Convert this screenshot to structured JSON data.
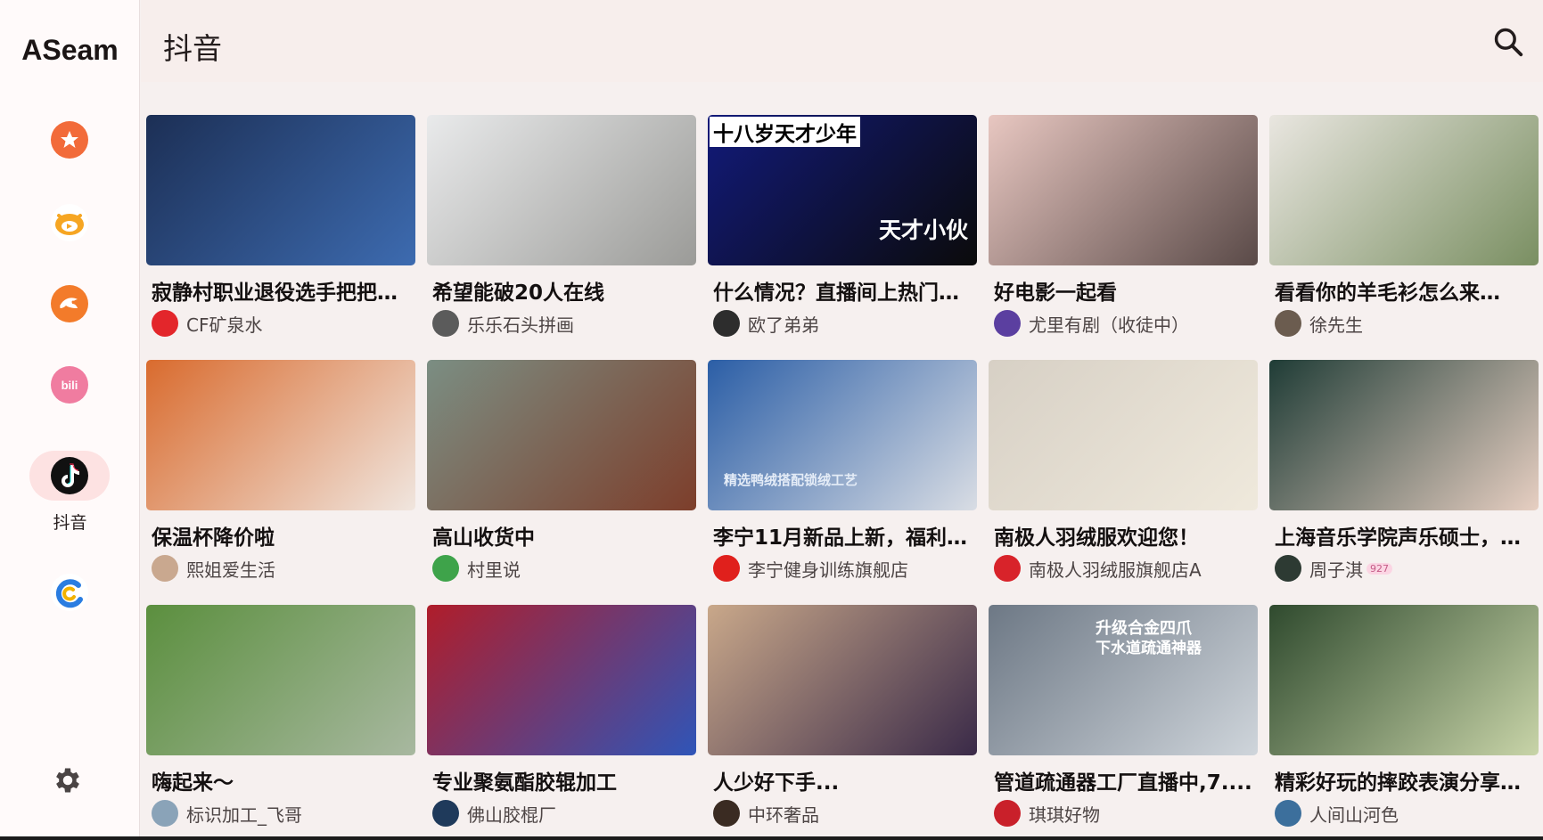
{
  "app": {
    "brand": "ASeam"
  },
  "rail": {
    "items": [
      {
        "id": "favorites",
        "icon": "star-icon",
        "color": "#f26b3a",
        "label": ""
      },
      {
        "id": "huya",
        "icon": "huya-icon",
        "color": "#f6a623",
        "label": ""
      },
      {
        "id": "douyu",
        "icon": "douyu-icon",
        "color": "#f37b2a",
        "label": ""
      },
      {
        "id": "bilibili",
        "icon": "bilibili-icon",
        "color": "#f07ca0",
        "label": ""
      },
      {
        "id": "douyin",
        "icon": "douyin-icon",
        "color": "#111111",
        "label": "抖音",
        "active": true
      },
      {
        "id": "cc",
        "icon": "cc-icon",
        "color": "#2a7de1",
        "label": ""
      }
    ],
    "settings_icon": "gear-icon"
  },
  "header": {
    "title": "抖音",
    "search_icon": "search-icon"
  },
  "cards": [
    {
      "title": "寂静村职业退役选手把把…",
      "author": "CF矿泉水",
      "thumb_colors": [
        "#1c2f55",
        "#3d6bb0"
      ],
      "avatar_color": "#e3262b"
    },
    {
      "title": "希望能破20人在线",
      "author": "乐乐石头拼画",
      "thumb_colors": [
        "#e9eaeb",
        "#9b9b98"
      ],
      "avatar_color": "#5b5b5b"
    },
    {
      "title": "什么情况？直播间上热门…",
      "author": "欧了弟弟",
      "thumb_colors": [
        "#121a7a",
        "#0b0b0b"
      ],
      "avatar_color": "#2d2d2d",
      "overlay_top": "十八岁天才少年",
      "overlay_right": "天才小伙"
    },
    {
      "title": "好电影一起看",
      "author": "尤里有剧（收徒中）",
      "thumb_colors": [
        "#e8c7c1",
        "#5a4a48"
      ],
      "avatar_color": "#5b3fa0"
    },
    {
      "title": "看看你的羊毛衫怎么来…",
      "author": "徐先生",
      "thumb_colors": [
        "#e9e6e0",
        "#7a8f62"
      ],
      "avatar_color": "#6b5c4f"
    },
    {
      "title": "保温杯降价啦",
      "author": "熙姐爱生活",
      "thumb_colors": [
        "#d96b2e",
        "#f0e6df"
      ],
      "avatar_color": "#c9a88f"
    },
    {
      "title": "高山收货中",
      "author": "村里说",
      "thumb_colors": [
        "#7b8e83",
        "#7d3e2b"
      ],
      "avatar_color": "#3ea34a"
    },
    {
      "title": "李宁11月新品上新，福利…",
      "author": "李宁健身训练旗舰店",
      "thumb_colors": [
        "#2b5ea6",
        "#d9dde4"
      ],
      "avatar_color": "#e0201c",
      "overlay_bottom": "精选鸭绒搭配锁绒工艺"
    },
    {
      "title": "南极人羽绒服欢迎您！",
      "author": "南极人羽绒服旗舰店A",
      "thumb_colors": [
        "#d7d0c5",
        "#efe9dc"
      ],
      "avatar_color": "#d8232a"
    },
    {
      "title": "上海音乐学院声乐硕士，…",
      "author": "周子淇",
      "thumb_colors": [
        "#1f3c36",
        "#e7cfc2"
      ],
      "avatar_color": "#2d3a33",
      "author_badge": "927"
    },
    {
      "title": "嗨起来～",
      "author": "标识加工_飞哥",
      "thumb_colors": [
        "#5b8f3e",
        "#a8b8a0"
      ],
      "avatar_color": "#8aa3b8"
    },
    {
      "title": "专业聚氨酯胶辊加工",
      "author": "佛山胶棍厂",
      "thumb_colors": [
        "#b01d2a",
        "#2f55b8"
      ],
      "avatar_color": "#1f3a5b"
    },
    {
      "title": "人少好下手...",
      "author": "中环奢品",
      "thumb_colors": [
        "#c9a88a",
        "#3a2a48"
      ],
      "avatar_color": "#3a2b22"
    },
    {
      "title": "管道疏通器工厂直播中,7....",
      "author": "琪琪好物",
      "thumb_colors": [
        "#6d7885",
        "#cfd5db"
      ],
      "avatar_color": "#c9202a",
      "overlay_top": "升级合金四爪",
      "overlay_sub": "下水道疏通神器"
    },
    {
      "title": "精彩好玩的摔跤表演分享…",
      "author": "人间山河色",
      "thumb_colors": [
        "#2f4a2e",
        "#c8d4a8"
      ],
      "avatar_color": "#3c6f9c"
    }
  ]
}
